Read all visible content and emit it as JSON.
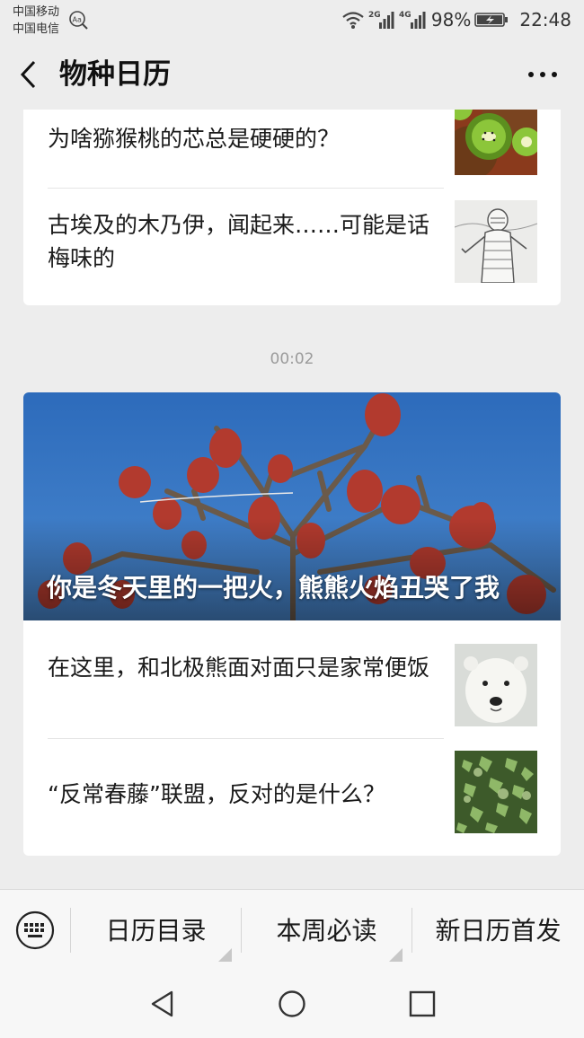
{
  "status_bar": {
    "carrier_1": "中国移动",
    "carrier_2": "中国电信",
    "net_1": "2G",
    "net_2": "4G",
    "battery": "98%",
    "time": "22:48"
  },
  "nav": {
    "title": "物种日历"
  },
  "feed": {
    "group_1": {
      "items": [
        {
          "title": "为啥猕猴桃的芯总是硬硬的？",
          "thumb": "kiwi-image"
        },
        {
          "title": "古埃及的木乃伊，闻起来……可能是话梅味的",
          "thumb": "mummy-sketch-image"
        }
      ]
    },
    "timestamp": "00:02",
    "group_2": {
      "cover_title": "你是冬天里的一把火，熊熊火焰丑哭了我",
      "items": [
        {
          "title": "在这里，和北极熊面对面只是家常便饭",
          "thumb": "polar-bear-image"
        },
        {
          "title": "“反常春藤”联盟，反对的是什么？",
          "thumb": "ivy-image"
        }
      ]
    }
  },
  "menu": {
    "items": [
      "日历目录",
      "本周必读",
      "新日历首发"
    ]
  },
  "colors": {
    "background": "#ededed",
    "card": "#ffffff",
    "sky": "#2f6fbf",
    "sumac_red": "#b23a2e"
  }
}
